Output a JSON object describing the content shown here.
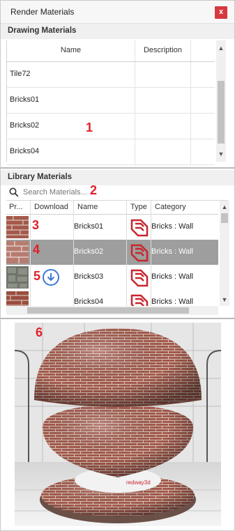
{
  "window": {
    "title": "Render Materials",
    "close_label": "x"
  },
  "drawing_materials": {
    "heading": "Drawing Materials",
    "columns": [
      "Name",
      "Description"
    ],
    "rows": [
      {
        "name": "Tile72"
      },
      {
        "name": "Bricks01"
      },
      {
        "name": "Bricks02"
      },
      {
        "name": "Bricks04"
      }
    ]
  },
  "library_materials": {
    "heading": "Library Materials",
    "search_placeholder": "Search Materials...",
    "columns": [
      "Pr...",
      "Download",
      "Name",
      "Type",
      "Category"
    ],
    "rows": [
      {
        "name": "Bricks01",
        "category": "Bricks : Wall",
        "selected": false,
        "download": false
      },
      {
        "name": "Bricks02",
        "category": "Bricks : Wall",
        "selected": true,
        "download": false
      },
      {
        "name": "Bricks03",
        "category": "Bricks : Wall",
        "selected": false,
        "download": true
      },
      {
        "name": "Bricks04",
        "category": "Bricks : Wall",
        "selected": false,
        "download": false
      }
    ]
  },
  "markers": [
    "1",
    "2",
    "3",
    "4",
    "5",
    "6"
  ],
  "preview": {
    "watermark": "redway3d"
  },
  "colors": {
    "accent": "#3b78d8",
    "close": "#d63a3f",
    "marker": "#e0202a",
    "selection": "#9e9e9e",
    "type_icon": "#c8252d"
  },
  "icons": {
    "search": "search-icon",
    "download": "download-icon",
    "type": "material-type-icon",
    "close": "close-icon"
  }
}
